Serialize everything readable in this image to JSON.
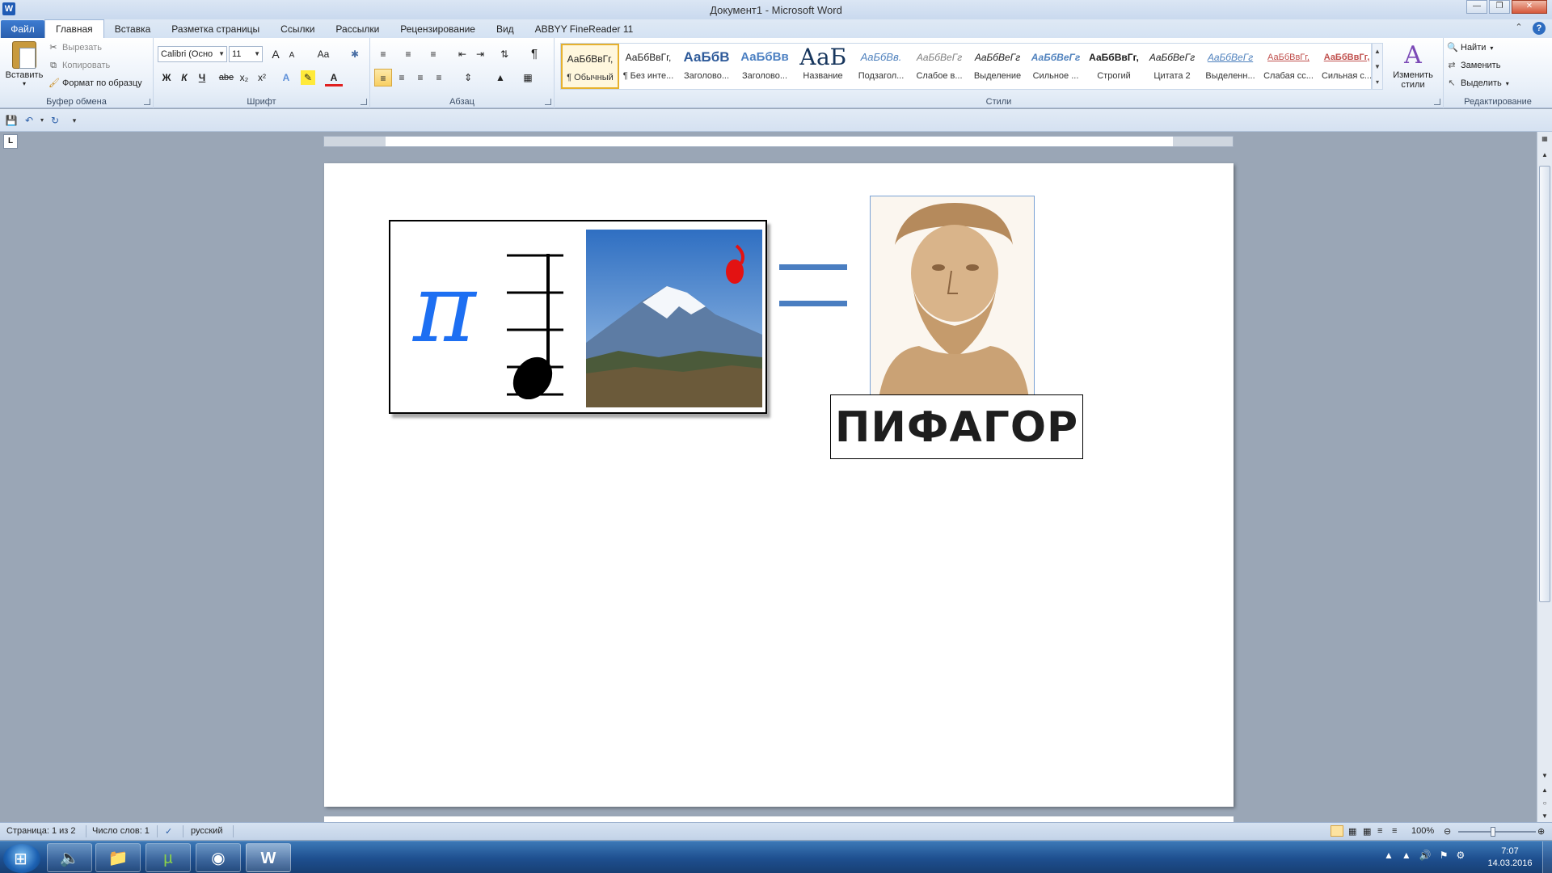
{
  "window": {
    "title": "Документ1  -  Microsoft Word",
    "app_icon_letter": "W"
  },
  "tabs": {
    "file": "Файл",
    "items": [
      "Главная",
      "Вставка",
      "Разметка страницы",
      "Ссылки",
      "Рассылки",
      "Рецензирование",
      "Вид",
      "ABBYY FineReader 11"
    ],
    "active_index": 0
  },
  "ribbon": {
    "clipboard": {
      "label": "Буфер обмена",
      "paste": "Вставить",
      "cut": "Вырезать",
      "copy": "Копировать",
      "format_painter": "Формат по образцу"
    },
    "font": {
      "label": "Шрифт",
      "font_name": "Calibri (Осно",
      "font_size": "11",
      "bold": "Ж",
      "italic": "К",
      "underline": "Ч",
      "strike": "abe",
      "subscript": "x₂",
      "superscript": "x²",
      "grow": "A",
      "shrink": "A",
      "case": "Aa"
    },
    "paragraph": {
      "label": "Абзац",
      "pilcrow": "¶"
    },
    "styles": {
      "label": "Стили",
      "items": [
        {
          "sample": "АаБбВвГг,",
          "name": "¶ Обычный",
          "selected": true
        },
        {
          "sample": "АаБбВвГг,",
          "name": "¶ Без инте...",
          "selected": false
        },
        {
          "sample": "АаБбВ",
          "name": "Заголово...",
          "selected": false
        },
        {
          "sample": "АаБбВв",
          "name": "Заголово...",
          "selected": false
        },
        {
          "sample": "АаБ",
          "name": "Название",
          "selected": false
        },
        {
          "sample": "АаБбВв.",
          "name": "Подзагол...",
          "selected": false
        },
        {
          "sample": "АаБбВеГг",
          "name": "Слабое в...",
          "selected": false
        },
        {
          "sample": "АаБбВеГг",
          "name": "Выделение",
          "selected": false
        },
        {
          "sample": "АаБбВеГг",
          "name": "Сильное ...",
          "selected": false
        },
        {
          "sample": "АаБбВвГг,",
          "name": "Строгий",
          "selected": false
        },
        {
          "sample": "АаБбВеГг",
          "name": "Цитата 2",
          "selected": false
        },
        {
          "sample": "АаБбВеГг",
          "name": "Выделенн...",
          "selected": false
        },
        {
          "sample": "АаБбВвГг,",
          "name": "Слабая сс...",
          "selected": false
        },
        {
          "sample": "АаБбВвГг,",
          "name": "Сильная с...",
          "selected": false
        }
      ],
      "change_styles": "Изменить стили"
    },
    "editing": {
      "label": "Редактирование",
      "find": "Найти",
      "replace": "Заменить",
      "select": "Выделить"
    }
  },
  "document": {
    "name_caption": "ПИФАГОР",
    "pi_symbol": "π"
  },
  "statusbar": {
    "page": "Страница: 1 из 2",
    "words": "Число слов: 1",
    "language": "русский",
    "zoom": "100%"
  },
  "taskbar": {
    "time": "7:07",
    "date": "14.03.2016"
  },
  "colors": {
    "accent": "#2a5fae",
    "pi_blue": "#1d6ff2",
    "equals_blue": "#4a7ec1"
  }
}
